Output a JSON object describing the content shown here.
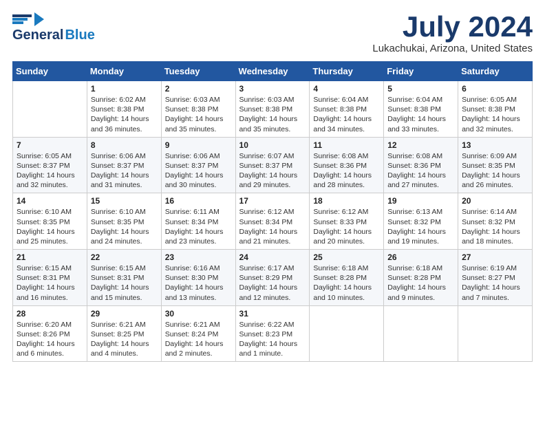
{
  "header": {
    "logo_line1": "General",
    "logo_line2": "Blue",
    "month_title": "July 2024",
    "location": "Lukachukai, Arizona, United States"
  },
  "days_of_week": [
    "Sunday",
    "Monday",
    "Tuesday",
    "Wednesday",
    "Thursday",
    "Friday",
    "Saturday"
  ],
  "weeks": [
    [
      {
        "day": "",
        "content": ""
      },
      {
        "day": "1",
        "content": "Sunrise: 6:02 AM\nSunset: 8:38 PM\nDaylight: 14 hours\nand 36 minutes."
      },
      {
        "day": "2",
        "content": "Sunrise: 6:03 AM\nSunset: 8:38 PM\nDaylight: 14 hours\nand 35 minutes."
      },
      {
        "day": "3",
        "content": "Sunrise: 6:03 AM\nSunset: 8:38 PM\nDaylight: 14 hours\nand 35 minutes."
      },
      {
        "day": "4",
        "content": "Sunrise: 6:04 AM\nSunset: 8:38 PM\nDaylight: 14 hours\nand 34 minutes."
      },
      {
        "day": "5",
        "content": "Sunrise: 6:04 AM\nSunset: 8:38 PM\nDaylight: 14 hours\nand 33 minutes."
      },
      {
        "day": "6",
        "content": "Sunrise: 6:05 AM\nSunset: 8:38 PM\nDaylight: 14 hours\nand 32 minutes."
      }
    ],
    [
      {
        "day": "7",
        "content": "Sunrise: 6:05 AM\nSunset: 8:37 PM\nDaylight: 14 hours\nand 32 minutes."
      },
      {
        "day": "8",
        "content": "Sunrise: 6:06 AM\nSunset: 8:37 PM\nDaylight: 14 hours\nand 31 minutes."
      },
      {
        "day": "9",
        "content": "Sunrise: 6:06 AM\nSunset: 8:37 PM\nDaylight: 14 hours\nand 30 minutes."
      },
      {
        "day": "10",
        "content": "Sunrise: 6:07 AM\nSunset: 8:37 PM\nDaylight: 14 hours\nand 29 minutes."
      },
      {
        "day": "11",
        "content": "Sunrise: 6:08 AM\nSunset: 8:36 PM\nDaylight: 14 hours\nand 28 minutes."
      },
      {
        "day": "12",
        "content": "Sunrise: 6:08 AM\nSunset: 8:36 PM\nDaylight: 14 hours\nand 27 minutes."
      },
      {
        "day": "13",
        "content": "Sunrise: 6:09 AM\nSunset: 8:35 PM\nDaylight: 14 hours\nand 26 minutes."
      }
    ],
    [
      {
        "day": "14",
        "content": "Sunrise: 6:10 AM\nSunset: 8:35 PM\nDaylight: 14 hours\nand 25 minutes."
      },
      {
        "day": "15",
        "content": "Sunrise: 6:10 AM\nSunset: 8:35 PM\nDaylight: 14 hours\nand 24 minutes."
      },
      {
        "day": "16",
        "content": "Sunrise: 6:11 AM\nSunset: 8:34 PM\nDaylight: 14 hours\nand 23 minutes."
      },
      {
        "day": "17",
        "content": "Sunrise: 6:12 AM\nSunset: 8:34 PM\nDaylight: 14 hours\nand 21 minutes."
      },
      {
        "day": "18",
        "content": "Sunrise: 6:12 AM\nSunset: 8:33 PM\nDaylight: 14 hours\nand 20 minutes."
      },
      {
        "day": "19",
        "content": "Sunrise: 6:13 AM\nSunset: 8:32 PM\nDaylight: 14 hours\nand 19 minutes."
      },
      {
        "day": "20",
        "content": "Sunrise: 6:14 AM\nSunset: 8:32 PM\nDaylight: 14 hours\nand 18 minutes."
      }
    ],
    [
      {
        "day": "21",
        "content": "Sunrise: 6:15 AM\nSunset: 8:31 PM\nDaylight: 14 hours\nand 16 minutes."
      },
      {
        "day": "22",
        "content": "Sunrise: 6:15 AM\nSunset: 8:31 PM\nDaylight: 14 hours\nand 15 minutes."
      },
      {
        "day": "23",
        "content": "Sunrise: 6:16 AM\nSunset: 8:30 PM\nDaylight: 14 hours\nand 13 minutes."
      },
      {
        "day": "24",
        "content": "Sunrise: 6:17 AM\nSunset: 8:29 PM\nDaylight: 14 hours\nand 12 minutes."
      },
      {
        "day": "25",
        "content": "Sunrise: 6:18 AM\nSunset: 8:28 PM\nDaylight: 14 hours\nand 10 minutes."
      },
      {
        "day": "26",
        "content": "Sunrise: 6:18 AM\nSunset: 8:28 PM\nDaylight: 14 hours\nand 9 minutes."
      },
      {
        "day": "27",
        "content": "Sunrise: 6:19 AM\nSunset: 8:27 PM\nDaylight: 14 hours\nand 7 minutes."
      }
    ],
    [
      {
        "day": "28",
        "content": "Sunrise: 6:20 AM\nSunset: 8:26 PM\nDaylight: 14 hours\nand 6 minutes."
      },
      {
        "day": "29",
        "content": "Sunrise: 6:21 AM\nSunset: 8:25 PM\nDaylight: 14 hours\nand 4 minutes."
      },
      {
        "day": "30",
        "content": "Sunrise: 6:21 AM\nSunset: 8:24 PM\nDaylight: 14 hours\nand 2 minutes."
      },
      {
        "day": "31",
        "content": "Sunrise: 6:22 AM\nSunset: 8:23 PM\nDaylight: 14 hours\nand 1 minute."
      },
      {
        "day": "",
        "content": ""
      },
      {
        "day": "",
        "content": ""
      },
      {
        "day": "",
        "content": ""
      }
    ]
  ]
}
